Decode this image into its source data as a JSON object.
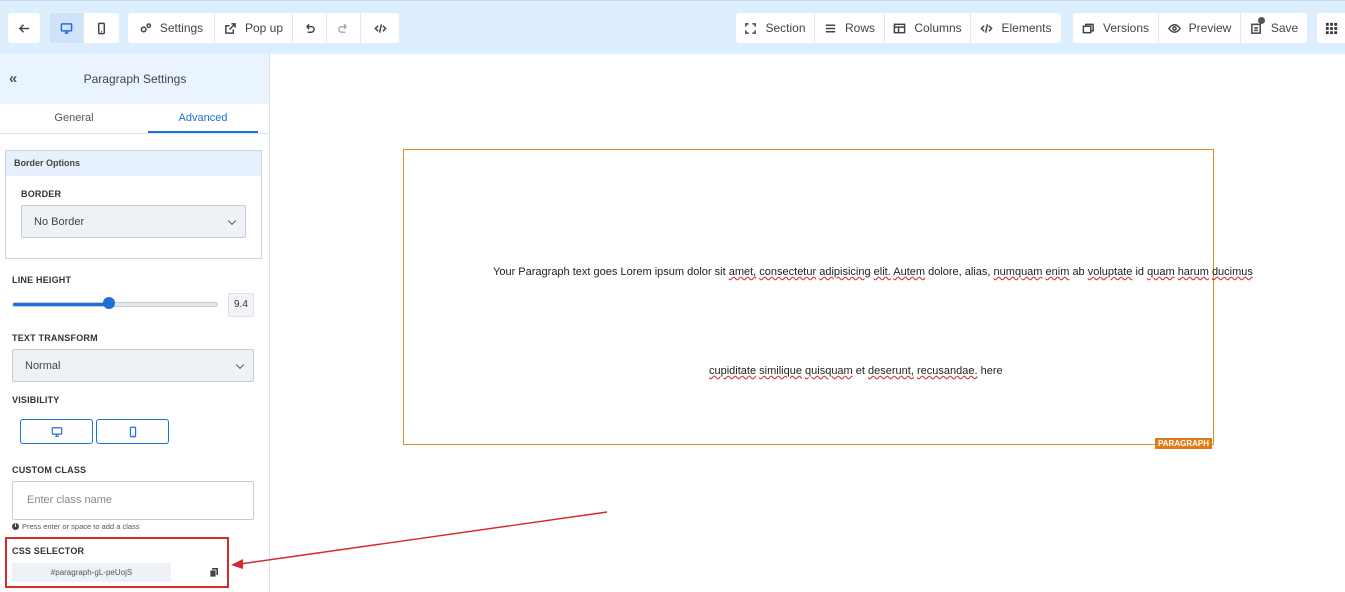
{
  "toolbar": {
    "settings": "Settings",
    "popup": "Pop up",
    "section": "Section",
    "rows": "Rows",
    "columns": "Columns",
    "elements": "Elements",
    "versions": "Versions",
    "preview": "Preview",
    "save": "Save",
    "icons": [
      "back-arrow-icon",
      "desktop-icon",
      "mobile-icon",
      "gears-icon",
      "popup-icon",
      "undo-icon",
      "redo-icon",
      "code-icon",
      "section-icon",
      "rows-icon",
      "columns-icon",
      "code-icon",
      "versions-icon",
      "eye-icon",
      "save-icon",
      "grid-icon"
    ]
  },
  "sidebar": {
    "title": "Paragraph Settings",
    "tabs": [
      "General",
      "Advanced"
    ],
    "active_tab": "Advanced",
    "border_options": {
      "header": "Border Options",
      "border_label": "BORDER",
      "border_value": "No Border"
    },
    "line_height": {
      "label": "LINE HEIGHT",
      "value": "9.4",
      "fraction": 0.47
    },
    "text_transform": {
      "label": "TEXT TRANSFORM",
      "value": "Normal"
    },
    "visibility": {
      "label": "VISIBILITY"
    },
    "custom_class": {
      "label": "CUSTOM CLASS",
      "placeholder": "Enter class name",
      "hint": "Press enter or space to add a class"
    },
    "css_selector": {
      "label": "CSS SELECTOR",
      "value": "#paragraph-gL-peUojS"
    }
  },
  "canvas": {
    "paragraph_line1": "Your Paragraph text goes Lorem ipsum dolor sit amet, consectetur adipisicing elit. Autem dolore, alias, numquam enim ab voluptate id quam harum ducimus",
    "paragraph_line2": "cupiditate similique quisquam et deserunt, recusandae. here",
    "element_tag": "PARAGRAPH"
  },
  "colors": {
    "accent": "#1e6fd9",
    "highlight": "#d42a2a",
    "element_border": "#e08a2a",
    "topbar": "#ddeefe"
  }
}
